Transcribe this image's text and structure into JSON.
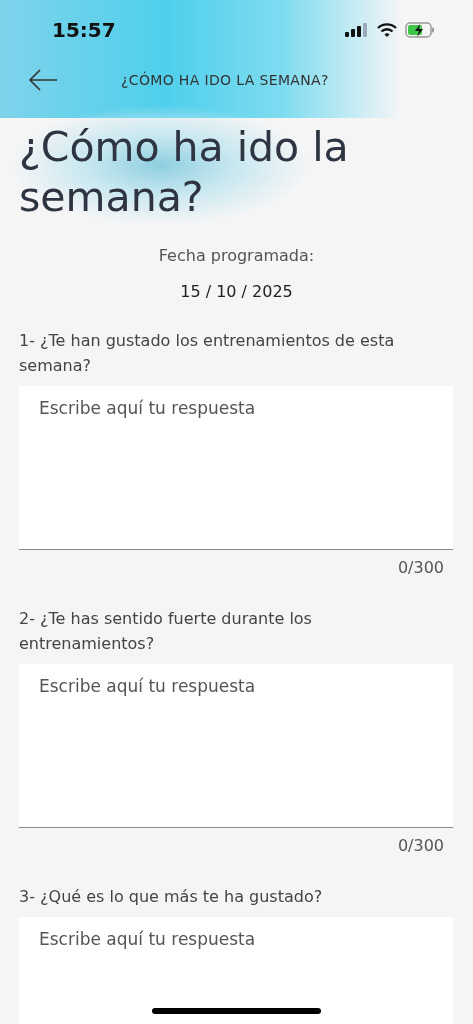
{
  "status_bar": {
    "time": "15:57"
  },
  "header": {
    "title": "¿CÓMO HA IDO LA SEMANA?"
  },
  "page_title": "¿Cómo ha ido la semana?",
  "schedule": {
    "label": "Fecha programada:",
    "date": "15 / 10 / 2025"
  },
  "questions": [
    {
      "label": "1- ¿Te han gustado los entrenamientos de esta semana?",
      "placeholder": "Escribe aquí tu respuesta",
      "counter": "0/300"
    },
    {
      "label": "2- ¿Te has sentido fuerte durante los entrenamientos?",
      "placeholder": "Escribe aquí tu respuesta",
      "counter": "0/300"
    },
    {
      "label": "3- ¿Qué es lo que más te ha gustado?",
      "placeholder": "Escribe aquí tu respuesta"
    }
  ]
}
